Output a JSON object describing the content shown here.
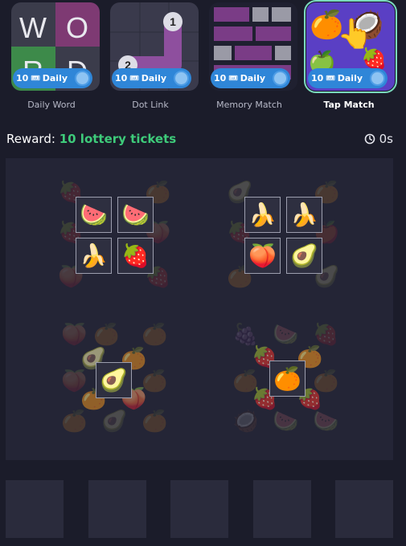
{
  "games": [
    {
      "label": "Daily Word",
      "badge_count": "10",
      "badge_text": "Daily",
      "active": false
    },
    {
      "label": "Dot Link",
      "badge_count": "10",
      "badge_text": "Daily",
      "active": false
    },
    {
      "label": "Memory Match",
      "badge_count": "10",
      "badge_text": "Daily",
      "active": false
    },
    {
      "label": "Tap Match",
      "badge_count": "10",
      "badge_text": "Daily",
      "active": true
    }
  ],
  "thumbs": {
    "word_letters": [
      "W",
      "O",
      "R",
      "D"
    ],
    "dot_numbers": [
      "1",
      "2"
    ]
  },
  "reward": {
    "label": "Reward:",
    "value": "10 lottery tickets"
  },
  "timer": {
    "value": "0s"
  },
  "clusters": [
    {
      "tiles": [
        "🍉",
        "🍉",
        "🍌",
        "🍓"
      ]
    },
    {
      "tiles": [
        "🍌",
        "🍌",
        "🍑",
        "🥑"
      ]
    },
    {
      "tiles": [
        "🥑"
      ]
    },
    {
      "tiles": [
        "🍊"
      ]
    }
  ],
  "colors": {
    "accent_green": "#3ecb7a",
    "badge_blue": "#2f86d8",
    "background": "#1b1c2a"
  }
}
